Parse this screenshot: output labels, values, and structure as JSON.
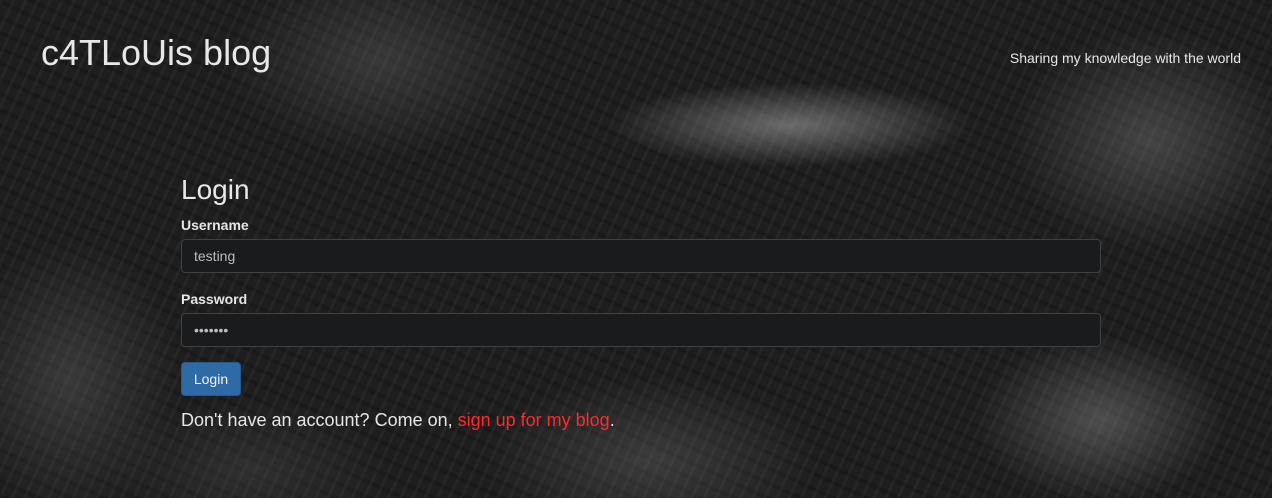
{
  "header": {
    "title": "c4TLoUis blog",
    "tagline": "Sharing my knowledge with the world"
  },
  "login": {
    "heading": "Login",
    "username_label": "Username",
    "username_value": "testing",
    "password_label": "Password",
    "password_value": "•••••••",
    "button_label": "Login",
    "signup_prefix": "Don't have an account? Come on, ",
    "signup_link": "sign up for my blog",
    "signup_suffix": "."
  },
  "colors": {
    "accent_link": "#ff2a2a",
    "button": "#2e6aa6"
  }
}
